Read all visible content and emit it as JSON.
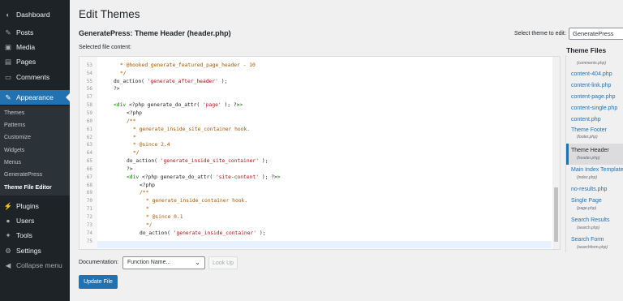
{
  "sidebar": {
    "items": [
      {
        "label": "Dashboard",
        "icon": "dashboard-icon",
        "glyph": "◐"
      },
      {
        "label": "Posts",
        "icon": "pin-icon",
        "glyph": "✎"
      },
      {
        "label": "Media",
        "icon": "media-icon",
        "glyph": "▣"
      },
      {
        "label": "Pages",
        "icon": "pages-icon",
        "glyph": "▤"
      },
      {
        "label": "Comments",
        "icon": "comments-icon",
        "glyph": "▭"
      },
      {
        "label": "Appearance",
        "icon": "brush-icon",
        "glyph": "✎",
        "active": true
      },
      {
        "label": "Plugins",
        "icon": "plugin-icon",
        "glyph": "⚡"
      },
      {
        "label": "Users",
        "icon": "users-icon",
        "glyph": "●"
      },
      {
        "label": "Tools",
        "icon": "wrench-icon",
        "glyph": "✦"
      },
      {
        "label": "Settings",
        "icon": "settings-icon",
        "glyph": "⚙"
      }
    ],
    "submenu": [
      "Themes",
      "Patterns",
      "Customize",
      "Widgets",
      "Menus",
      "GeneratePress",
      "Theme File Editor"
    ],
    "collapse_label": "Collapse menu"
  },
  "main": {
    "page_title": "Edit Themes",
    "file_title": "GeneratePress: Theme Header (header.php)",
    "select_theme_label": "Select theme to edit:",
    "selected_theme": "GeneratePress",
    "selected_file_label": "Selected file content:"
  },
  "editor": {
    "lines": [
      {
        "num": "",
        "tokens": [
          {
            "t": "*",
            "c": "cmt"
          }
        ],
        "indent": 2
      },
      {
        "num": "53",
        "tokens": [
          {
            "t": "* @hooked generate_featured_page_header - 10",
            "c": "cmt"
          }
        ],
        "indent": 2
      },
      {
        "num": "54",
        "tokens": [
          {
            "t": "*/",
            "c": "cmt"
          }
        ],
        "indent": 2
      },
      {
        "num": "55",
        "tokens": [
          {
            "t": "do_action( ",
            "c": "def"
          },
          {
            "t": "'generate_after_header'",
            "c": "str"
          },
          {
            "t": " );",
            "c": "def"
          }
        ],
        "indent": 1
      },
      {
        "num": "56",
        "tokens": [
          {
            "t": "?>",
            "c": "def"
          }
        ],
        "indent": 1
      },
      {
        "num": "57",
        "tokens": [],
        "indent": 0
      },
      {
        "num": "58",
        "tokens": [
          {
            "t": "<div ",
            "c": "tag"
          },
          {
            "t": "<?php generate_do_attr( ",
            "c": "def"
          },
          {
            "t": "'page'",
            "c": "str"
          },
          {
            "t": " ); ?>",
            "c": "def"
          },
          {
            "t": ">",
            "c": "tag"
          }
        ],
        "indent": 1
      },
      {
        "num": "59",
        "tokens": [
          {
            "t": "<?php",
            "c": "def"
          }
        ],
        "indent": 3
      },
      {
        "num": "60",
        "tokens": [
          {
            "t": "/**",
            "c": "cmt"
          }
        ],
        "indent": 3
      },
      {
        "num": "61",
        "tokens": [
          {
            "t": "* generate_inside_site_container hook.",
            "c": "cmt"
          }
        ],
        "indent": 4
      },
      {
        "num": "62",
        "tokens": [
          {
            "t": "*",
            "c": "cmt"
          }
        ],
        "indent": 4
      },
      {
        "num": "63",
        "tokens": [
          {
            "t": "* @since 2.4",
            "c": "cmt"
          }
        ],
        "indent": 4
      },
      {
        "num": "64",
        "tokens": [
          {
            "t": "*/",
            "c": "cmt"
          }
        ],
        "indent": 4
      },
      {
        "num": "65",
        "tokens": [
          {
            "t": "do_action( ",
            "c": "def"
          },
          {
            "t": "'generate_inside_site_container'",
            "c": "str"
          },
          {
            "t": " );",
            "c": "def"
          }
        ],
        "indent": 3
      },
      {
        "num": "66",
        "tokens": [
          {
            "t": "?>",
            "c": "def"
          }
        ],
        "indent": 3
      },
      {
        "num": "67",
        "tokens": [
          {
            "t": "<div ",
            "c": "tag"
          },
          {
            "t": "<?php generate_do_attr( ",
            "c": "def"
          },
          {
            "t": "'site-content'",
            "c": "str"
          },
          {
            "t": " ); ?>",
            "c": "def"
          },
          {
            "t": ">",
            "c": "tag"
          }
        ],
        "indent": 3
      },
      {
        "num": "68",
        "tokens": [
          {
            "t": "<?php",
            "c": "def"
          }
        ],
        "indent": 5
      },
      {
        "num": "69",
        "tokens": [
          {
            "t": "/**",
            "c": "cmt"
          }
        ],
        "indent": 5
      },
      {
        "num": "70",
        "tokens": [
          {
            "t": "* generate_inside_container hook.",
            "c": "cmt"
          }
        ],
        "indent": 6
      },
      {
        "num": "71",
        "tokens": [
          {
            "t": "*",
            "c": "cmt"
          }
        ],
        "indent": 6
      },
      {
        "num": "72",
        "tokens": [
          {
            "t": "* @since 0.1",
            "c": "cmt"
          }
        ],
        "indent": 6
      },
      {
        "num": "73",
        "tokens": [
          {
            "t": "*/",
            "c": "cmt"
          }
        ],
        "indent": 6
      },
      {
        "num": "74",
        "tokens": [
          {
            "t": "do_action( ",
            "c": "def"
          },
          {
            "t": "'generate_inside_container'",
            "c": "str"
          },
          {
            "t": " );",
            "c": "def"
          }
        ],
        "indent": 5
      },
      {
        "num": "75",
        "tokens": [],
        "indent": 0
      }
    ]
  },
  "theme_files": {
    "title": "Theme Files",
    "items": [
      {
        "label": "",
        "sub": "(comments.php)"
      },
      {
        "label": "content-404.php",
        "sub": ""
      },
      {
        "label": "content-link.php",
        "sub": ""
      },
      {
        "label": "content-page.php",
        "sub": ""
      },
      {
        "label": "content-single.php",
        "sub": ""
      },
      {
        "label": "content.php",
        "sub": ""
      },
      {
        "label": "Theme Footer",
        "sub": "(footer.php)"
      },
      {
        "label": "Theme Header",
        "sub": "(header.php)",
        "current": true
      },
      {
        "label": "Main Index Template",
        "sub": "(index.php)"
      },
      {
        "label": "no-results.php",
        "sub": ""
      },
      {
        "label": "Single Page",
        "sub": "(page.php)"
      },
      {
        "label": "Search Results",
        "sub": "(search.php)"
      },
      {
        "label": "Search Form",
        "sub": "(searchform.php)"
      }
    ]
  },
  "footer": {
    "documentation_label": "Documentation:",
    "function_placeholder": "Function Name...",
    "lookup_label": "Look Up",
    "update_label": "Update File"
  },
  "colors": {
    "accent": "#2271b1",
    "sidebar": "#1d2327",
    "submenu": "#2c3338"
  }
}
